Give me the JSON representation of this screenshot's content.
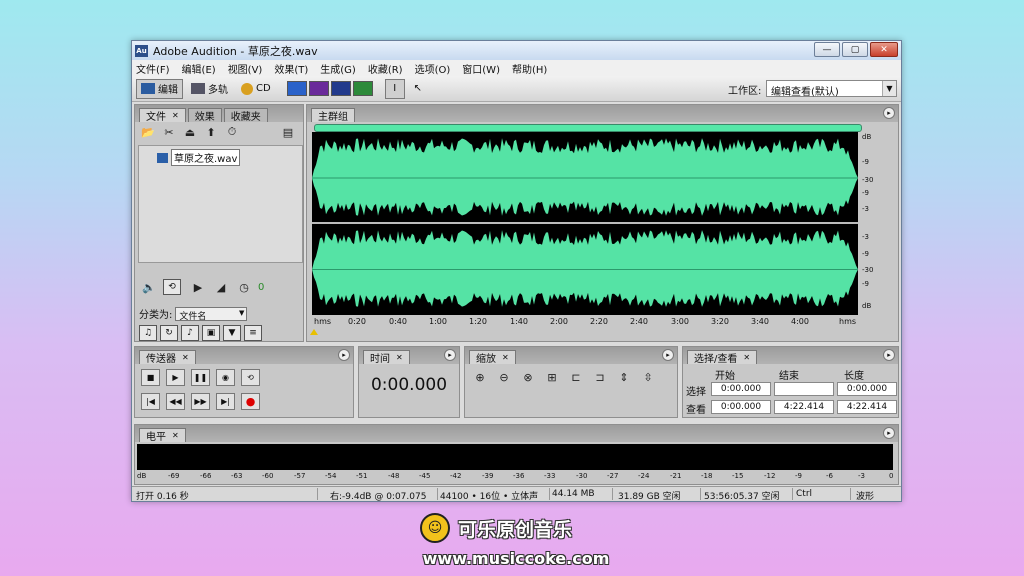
{
  "window": {
    "title": "Adobe Audition - 草原之夜.wav",
    "app_icon": "Au",
    "min": "—",
    "max": "▢",
    "close": "✕"
  },
  "menu": [
    "文件(F)",
    "编辑(E)",
    "视图(V)",
    "效果(T)",
    "生成(G)",
    "收藏(R)",
    "选项(O)",
    "窗口(W)",
    "帮助(H)"
  ],
  "toolbar": {
    "edit": "编辑",
    "multitrack": "多轨",
    "cd": "CD",
    "workspace_label": "工作区:",
    "workspace_value": "编辑查看(默认)"
  },
  "files_panel": {
    "tabs": [
      "文件",
      "效果",
      "收藏夹"
    ],
    "file": "草原之夜.wav",
    "sort_label": "分类为:",
    "sort_value": "文件名",
    "counter": "0"
  },
  "main_group": {
    "tab": "主群组",
    "db_left": "dB",
    "db_label_bottom": "dB",
    "db_ticks_top": [
      "-9",
      "-30",
      "-9",
      "-3"
    ],
    "db_ticks_bottom": [
      "-3",
      "-9",
      "-30",
      "-9"
    ],
    "time_ticks": [
      "hms",
      "0:20",
      "0:40",
      "1:00",
      "1:20",
      "1:40",
      "2:00",
      "2:20",
      "2:40",
      "3:00",
      "3:20",
      "3:40",
      "4:00",
      "hms"
    ]
  },
  "transport": {
    "tab": "传送器"
  },
  "time_panel": {
    "tab": "时间",
    "value": "0:00.000"
  },
  "zoom_panel": {
    "tab": "缩放"
  },
  "selection_panel": {
    "tab": "选择/查看",
    "col_start": "开始",
    "col_end": "结束",
    "col_length": "长度",
    "row_select": "选择",
    "row_view": "查看",
    "sel_start": "0:00.000",
    "sel_end": "",
    "sel_length": "0:00.000",
    "view_start": "0:00.000",
    "view_end": "4:22.414",
    "view_length": "4:22.414"
  },
  "level_panel": {
    "tab": "电平",
    "scale": [
      "dB",
      "-69",
      "-66",
      "-63",
      "-60",
      "-57",
      "-54",
      "-51",
      "-48",
      "-45",
      "-42",
      "-39",
      "-36",
      "-33",
      "-30",
      "-27",
      "-24",
      "-21",
      "-18",
      "-15",
      "-12",
      "-9",
      "-6",
      "-3",
      "0"
    ]
  },
  "status": {
    "open": "打开 0.16 秒",
    "right": "右:-9.4dB @ 0:07.075",
    "format": "44100 • 16位 • 立体声",
    "size": "44.14 MB",
    "disk": "31.89 GB 空闲",
    "time_free": "53:56:05.37 空闲",
    "ctrl": "Ctrl",
    "mode": "波形"
  },
  "brand": {
    "name": "可乐原创音乐",
    "url": "www.musiccoke.com"
  },
  "colors": {
    "waveform": "#55e3a5",
    "wave_bg": "#000000",
    "overview": "#56e7a8"
  }
}
